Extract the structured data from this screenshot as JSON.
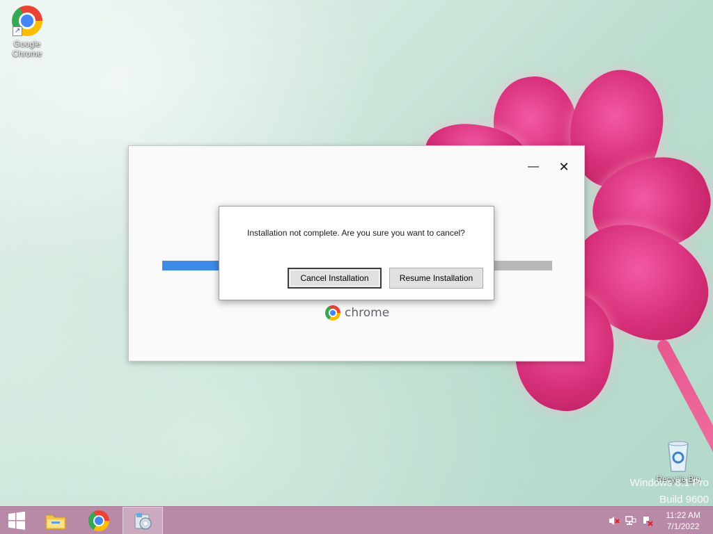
{
  "desktop": {
    "icons": [
      {
        "label": "Google Chrome"
      },
      {
        "label": "Recycle Bin"
      }
    ],
    "watermark": {
      "line1": "Windows 8.1 Pro",
      "line2": "Build 9600"
    }
  },
  "installer": {
    "minimize_glyph": "—",
    "close_glyph": "✕",
    "progress": 0.15,
    "brand_text": "chrome"
  },
  "dialog": {
    "message": "Installation not complete. Are you sure you want to cancel?",
    "cancel_label": "Cancel Installation",
    "resume_label": "Resume Installation"
  },
  "taskbar": {
    "items": [
      "start-icon",
      "file-explorer-icon",
      "chrome-icon",
      "installer-icon"
    ],
    "tray": [
      "volume-muted-icon",
      "network-icon",
      "action-center-icon"
    ],
    "time": "11:22 AM",
    "date": "7/1/2022"
  },
  "colors": {
    "progress_fill": "#3c8ce7",
    "taskbar": "#b88aa7"
  }
}
